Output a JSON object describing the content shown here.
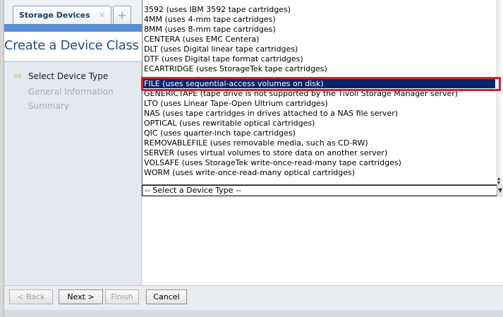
{
  "tab": {
    "label": "Storage Devices",
    "close_icon": "close-icon",
    "add_icon": "plus-icon"
  },
  "page_title": "Create a Device Class",
  "steps": [
    {
      "label": "Select Device Type",
      "state": "active",
      "icon": "arrow-right-icon"
    },
    {
      "label": "General Information",
      "state": "disabled"
    },
    {
      "label": "Summary",
      "state": "disabled"
    }
  ],
  "device_type_options": [
    "3592 (uses IBM 3592 tape cartridges)",
    "4MM (uses 4-mm tape cartridges)",
    "8MM (uses 8-mm tape cartridges)",
    "CENTERA (uses EMC Centera)",
    "DLT (uses Digital linear tape cartridges)",
    "DTF (uses Digital tape format cartridges)",
    "ECARTRIDGE (uses StorageTek tape cartridges)",
    "FILE (uses sequential-access volumes on disk)",
    "GENERICTAPE (tape drive is not supported by the Tivoli Storage Manager server)",
    "LTO (uses Linear Tape-Open Ultrium cartridges)",
    "NAS (uses tape cartridges in drives attached to a NAS file server)",
    "OPTICAL (uses rewritable optical cartridges)",
    "QIC (uses quarter-inch tape cartridges)",
    "REMOVABLEFILE (uses removable media, such as CD-RW)",
    "SERVER (uses virtual volumes to store data on another server)",
    "VOLSAFE (uses StorageTek write-once-read-many tape cartridges)",
    "WORM (uses write-once-read-many optical cartridges)"
  ],
  "selected_option_index": 7,
  "select_placeholder": "-- Select a Device Type --",
  "buttons": {
    "back": "< Back",
    "next": "Next >",
    "finish": "Finish",
    "cancel": "Cancel"
  },
  "colors": {
    "highlight_border": "#d81e2a",
    "selected_row": "#0a246a",
    "title": "#1f4e87",
    "tab_band": "#5b8fd6"
  }
}
